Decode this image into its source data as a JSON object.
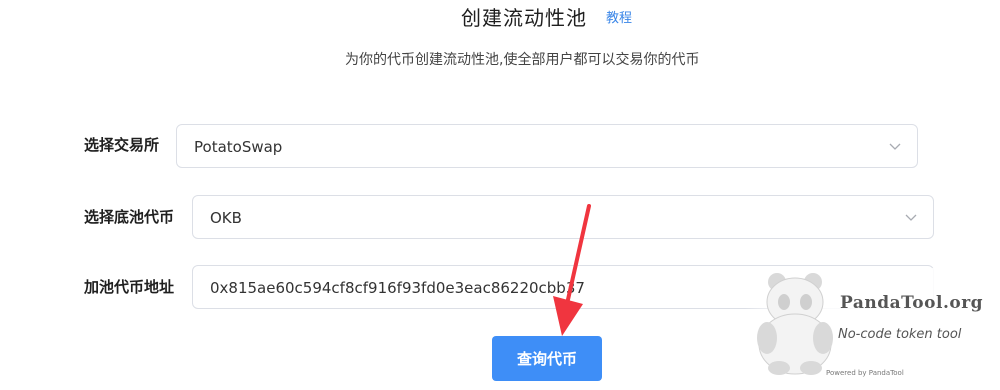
{
  "header": {
    "title": "创建流动性池",
    "tutorial_link": "教程",
    "subtitle": "为你的代币创建流动性池,使全部用户都可以交易你的代币"
  },
  "form": {
    "exchange": {
      "label": "选择交易所",
      "value": "PotatoSwap"
    },
    "base_token": {
      "label": "选择底池代币",
      "value": "OKB"
    },
    "token_address": {
      "label": "加池代币地址",
      "value": "0x815ae60c594cf8cf916f93fd0e3eac86220cbb37"
    },
    "submit_label": "查询代币"
  },
  "watermark": {
    "brand": "PandaTool.org",
    "tagline": "No-code token tool",
    "powered": "Powered by PandaTool"
  },
  "colors": {
    "accent": "#3e8ef7",
    "link": "#3a86e8",
    "annotation_arrow": "#f0353f"
  },
  "icons": {
    "dropdown": "chevron-down-icon",
    "annotation": "red-arrow-icon",
    "mascot": "panda-logo"
  }
}
